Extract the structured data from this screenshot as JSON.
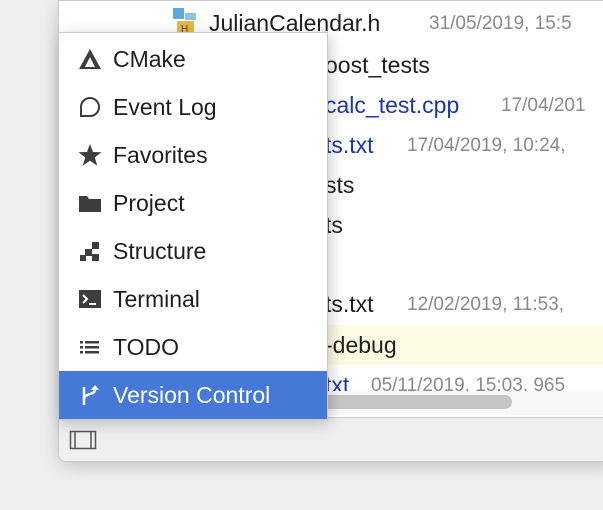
{
  "accent_color": "#4578d8",
  "tree": {
    "rows": [
      {
        "name": "JulianCalendar.h",
        "meta": "31/05/2019, 15:5"
      },
      {
        "name": "oost_tests",
        "meta": ""
      },
      {
        "name": "calc_test.cpp",
        "meta": "17/04/201"
      },
      {
        "name": "ts.txt",
        "meta": "17/04/2019, 10:24, "
      },
      {
        "name": "sts",
        "meta": ""
      },
      {
        "name": "ts",
        "meta": ""
      },
      {
        "name": "ts.txt",
        "meta": "12/02/2019, 11:53, "
      },
      {
        "name": "-debug",
        "meta": ""
      },
      {
        "name": "txt",
        "meta": "05/11/2019, 15:03, 965"
      }
    ]
  },
  "menu": {
    "items": [
      {
        "label": "CMake",
        "icon": "cmake-icon"
      },
      {
        "label": "Event Log",
        "icon": "event-log-icon"
      },
      {
        "label": "Favorites",
        "icon": "star-icon"
      },
      {
        "label": "Project",
        "icon": "folder-icon"
      },
      {
        "label": "Structure",
        "icon": "structure-icon"
      },
      {
        "label": "Terminal",
        "icon": "terminal-icon"
      },
      {
        "label": "TODO",
        "icon": "todo-list-icon"
      },
      {
        "label": "Version Control",
        "icon": "version-control-icon",
        "selected": true
      }
    ]
  }
}
